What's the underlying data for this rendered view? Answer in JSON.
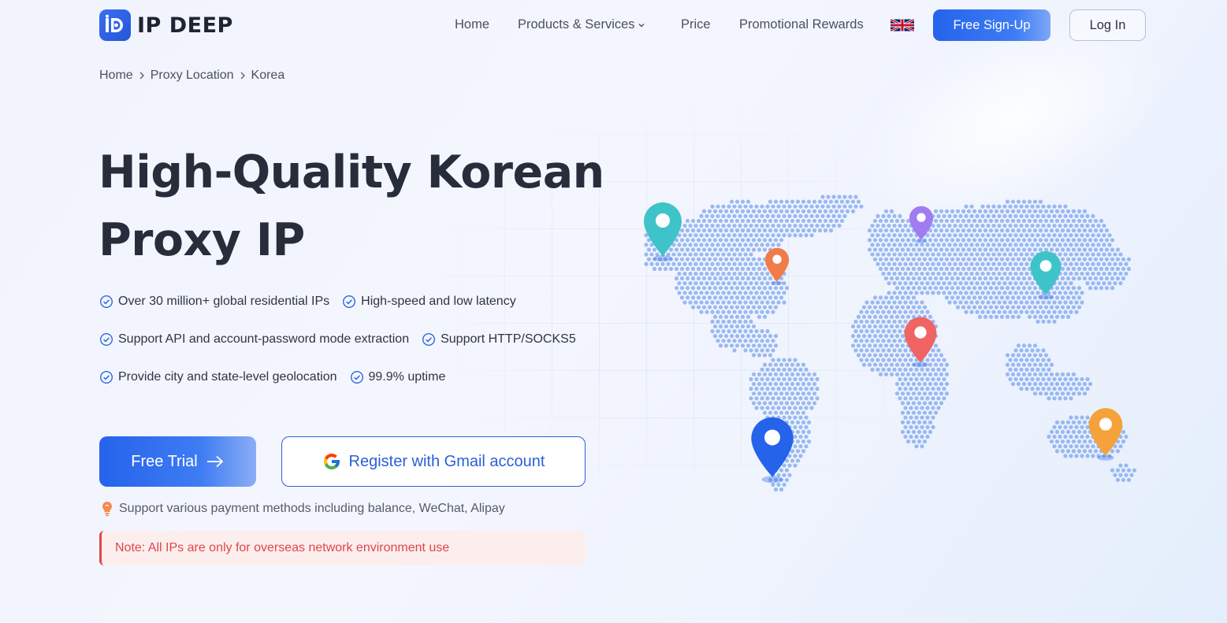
{
  "brand": {
    "name": "IP DEEP",
    "primary_color": "#2563eb"
  },
  "nav": {
    "items": [
      "Home",
      "Products & Services",
      "Price",
      "Promotional Rewards"
    ],
    "language_flag": "uk-flag-icon",
    "signup_label": "Free Sign-Up",
    "login_label": "Log In"
  },
  "breadcrumb": [
    "Home",
    "Proxy Location",
    "Korea"
  ],
  "hero": {
    "title_line1": "High-Quality Korean",
    "title_line2": "Proxy IP",
    "features": [
      "Over 30 million+ global residential IPs",
      "High-speed and low latency",
      "Support API and account-password mode extraction",
      "Support HTTP/SOCKS5",
      "Provide city and state-level geolocation",
      "99.9% uptime"
    ],
    "trial_label": "Free Trial",
    "gmail_label": "Register with Gmail account",
    "payment_note": "Support various payment methods including balance, WeChat, Alipay",
    "warning": "Note: All IPs are only for overseas network environment use"
  },
  "map": {
    "pin_colors": [
      "#3ec4c8",
      "#f07c4a",
      "#a07cf0",
      "#3ec4c8",
      "#f06464",
      "#2563eb",
      "#f5a23a"
    ]
  }
}
